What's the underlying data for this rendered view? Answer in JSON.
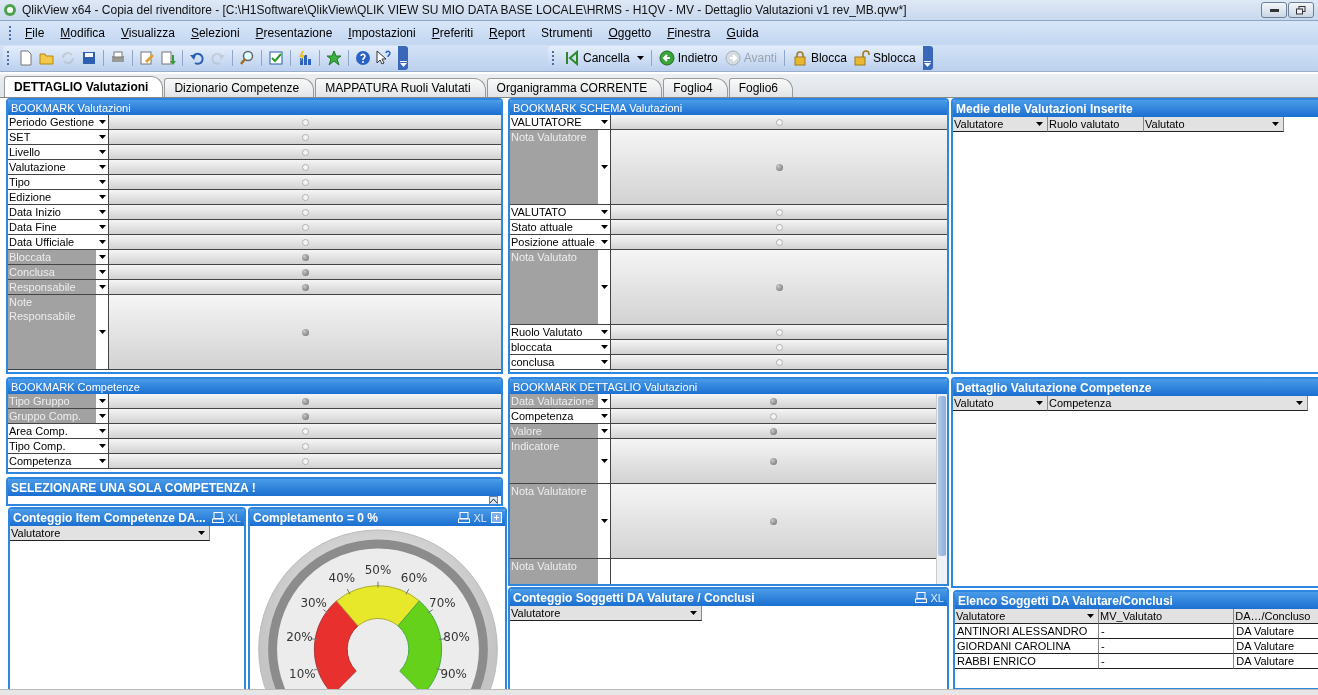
{
  "window": {
    "title": "QlikView x64 - Copia del rivenditore - [C:\\H1Software\\QlikView\\QLIK VIEW SU MIO DATA BASE LOCALE\\HRMS - H1QV - MV - Dettaglio Valutazioni v1 rev_MB.qvw*]"
  },
  "menu": [
    {
      "label": "File",
      "underlined": true
    },
    {
      "label": "Modifica",
      "underlined": true
    },
    {
      "label": "Visualizza",
      "underlined": true
    },
    {
      "label": "Selezioni",
      "underlined": true
    },
    {
      "label": "Presentazione",
      "underlined": true
    },
    {
      "label": "Impostazioni",
      "underlined": true
    },
    {
      "label": "Preferiti",
      "underlined": true
    },
    {
      "label": "Report",
      "underlined": true
    },
    {
      "label": "Strumenti",
      "underlined": false
    },
    {
      "label": "Oggetto",
      "underlined": true
    },
    {
      "label": "Finestra",
      "underlined": true
    },
    {
      "label": "Guida",
      "underlined": true
    }
  ],
  "toolbar": [
    {
      "kind": "new",
      "disabled": false
    },
    {
      "kind": "open",
      "disabled": false
    },
    {
      "kind": "reload",
      "disabled": true
    },
    {
      "kind": "save",
      "disabled": false
    },
    {
      "kind": "separator"
    },
    {
      "kind": "print",
      "disabled": false
    },
    {
      "kind": "separator"
    },
    {
      "kind": "edit",
      "disabled": false
    },
    {
      "kind": "import",
      "disabled": false
    },
    {
      "kind": "separator"
    },
    {
      "kind": "undo",
      "disabled": false
    },
    {
      "kind": "redo",
      "disabled": true
    },
    {
      "kind": "separator"
    },
    {
      "kind": "search",
      "disabled": false
    },
    {
      "kind": "separator"
    },
    {
      "kind": "check",
      "disabled": false
    },
    {
      "kind": "separator"
    },
    {
      "kind": "chart",
      "disabled": false
    },
    {
      "kind": "separator"
    },
    {
      "kind": "star",
      "disabled": false
    },
    {
      "kind": "separator"
    },
    {
      "kind": "help",
      "disabled": false
    },
    {
      "kind": "whatsthis",
      "disabled": false
    }
  ],
  "selection_toolbar": [
    {
      "kind": "clear",
      "label": "Cancella",
      "disabled": false,
      "dropdown": true
    },
    {
      "kind": "back",
      "label": "Indietro",
      "disabled": false,
      "dropdown": false
    },
    {
      "kind": "forward",
      "label": "Avanti",
      "disabled": true,
      "dropdown": false
    },
    {
      "kind": "lock",
      "label": "Blocca",
      "disabled": false,
      "dropdown": false
    },
    {
      "kind": "unlock",
      "label": "Sblocca",
      "disabled": false,
      "dropdown": false
    }
  ],
  "tabs": [
    {
      "label": "DETTAGLIO Valutazioni",
      "selected": true
    },
    {
      "label": "Dizionario Competenze",
      "selected": false
    },
    {
      "label": "MAPPATURA Ruoli Valutati",
      "selected": false
    },
    {
      "label": "Organigramma CORRENTE",
      "selected": false
    },
    {
      "label": "Foglio4",
      "selected": false
    },
    {
      "label": "Foglio6",
      "selected": false
    }
  ],
  "objects": [
    {
      "kind": "multibox",
      "title": "BOOKMARK Valutazioni",
      "fields": [
        {
          "label": "Periodo Gestione",
          "kind": "line",
          "greyed": false
        },
        {
          "label": "SET",
          "kind": "line",
          "greyed": false
        },
        {
          "label": "Livello",
          "kind": "line",
          "greyed": false
        },
        {
          "label": "Valutazione",
          "kind": "line",
          "greyed": false
        },
        {
          "label": "Tipo",
          "kind": "line",
          "greyed": false
        },
        {
          "label": "Edizione",
          "kind": "line",
          "greyed": false
        },
        {
          "label": "Data Inizio",
          "kind": "line",
          "greyed": false
        },
        {
          "label": "Data Fine",
          "kind": "line",
          "greyed": false
        },
        {
          "label": "Data Ufficiale",
          "kind": "line",
          "greyed": false
        },
        {
          "label": "Bloccata",
          "kind": "line",
          "greyed": true
        },
        {
          "label": "Conclusa",
          "kind": "line",
          "greyed": true
        },
        {
          "label": "Responsabile",
          "kind": "line",
          "greyed": true
        },
        {
          "label": "Note Responsabile",
          "kind": "memo",
          "greyed": true
        }
      ]
    },
    {
      "kind": "multibox",
      "title": "BOOKMARK SCHEMA Valutazioni",
      "fields": [
        {
          "label": "VALUTATORE",
          "kind": "line",
          "greyed": false
        },
        {
          "label": "Nota Valutatore",
          "kind": "memo",
          "greyed": true
        },
        {
          "label": "VALUTATO",
          "kind": "line",
          "greyed": false
        },
        {
          "label": "Stato attuale",
          "kind": "line",
          "greyed": false
        },
        {
          "label": "Posizione attuale",
          "kind": "line",
          "greyed": false
        },
        {
          "label": "Nota Valutato",
          "kind": "memo",
          "greyed": true
        },
        {
          "label": "Ruolo Valutato",
          "kind": "line",
          "greyed": false
        },
        {
          "label": "bloccata",
          "kind": "line",
          "greyed": false
        },
        {
          "label": "conclusa",
          "kind": "line",
          "greyed": false
        }
      ]
    },
    {
      "kind": "table",
      "title": "Medie delle Valutazioni Inserite",
      "columns": [
        {
          "label": "Valutatore",
          "dropdown": true
        },
        {
          "label": "Ruolo valutato",
          "dropdown": false
        },
        {
          "label": "Valutato",
          "dropdown": true
        }
      ]
    },
    {
      "kind": "multibox",
      "title": "BOOKMARK Competenze",
      "fields": [
        {
          "label": "Tipo Gruppo",
          "kind": "line",
          "greyed": true
        },
        {
          "label": "Gruppo Comp.",
          "kind": "line",
          "greyed": true
        },
        {
          "label": "Area Comp.",
          "kind": "line",
          "greyed": false
        },
        {
          "label": "Tipo Comp.",
          "kind": "line",
          "greyed": false
        },
        {
          "label": "Competenza",
          "kind": "line",
          "greyed": false
        }
      ]
    },
    {
      "kind": "multibox",
      "title": "BOOKMARK DETTAGLIO Valutazioni",
      "fields": [
        {
          "label": "Data Valutazione",
          "kind": "line",
          "greyed": true
        },
        {
          "label": "Competenza",
          "kind": "line",
          "greyed": false
        },
        {
          "label": "Valore",
          "kind": "line",
          "greyed": true
        },
        {
          "label": "Indicatore",
          "kind": "note",
          "greyed": true
        },
        {
          "label": "Nota Valutatore",
          "kind": "memo",
          "greyed": true
        },
        {
          "label": "Nota Valutato",
          "kind": "cut",
          "greyed": true
        }
      ]
    },
    {
      "kind": "table",
      "title": "Dettaglio Valutazione Competenze",
      "columns": [
        {
          "label": "Valutato",
          "dropdown": true
        },
        {
          "label": "Competenza",
          "dropdown": true
        }
      ]
    },
    {
      "kind": "text",
      "title": "SELEZIONARE UNA SOLA COMPETENZA !"
    },
    {
      "kind": "table",
      "title": "Conteggio Item Competenze DA...",
      "caption_buttons": [
        {
          "kind": "print"
        },
        {
          "kind": "excel",
          "label": "XL"
        }
      ],
      "columns": [
        {
          "label": "Valutatore",
          "dropdown": true
        }
      ]
    },
    {
      "kind": "gauge",
      "title": "Completamento = 0 %",
      "caption_buttons": [
        {
          "kind": "print"
        },
        {
          "kind": "excel",
          "label": "XL"
        },
        {
          "kind": "maximize"
        }
      ],
      "ticks": [
        "10%",
        "20%",
        "30%",
        "40%",
        "50%",
        "60%",
        "70%",
        "80%",
        "90%"
      ]
    },
    {
      "kind": "table",
      "title": "Conteggio Soggetti DA Valutare / Conclusi",
      "caption_buttons": [
        {
          "kind": "print"
        },
        {
          "kind": "excel",
          "label": "XL"
        }
      ],
      "columns": [
        {
          "label": "Valutatore",
          "dropdown": true
        }
      ]
    },
    {
      "kind": "table",
      "title": "Elenco Soggetti DA Valutare/Conclusi",
      "columns": [
        {
          "label": "Valutatore",
          "dropdown": true
        },
        {
          "label": "MV_Valutato",
          "dropdown": false
        },
        {
          "label": "DA…/Concluso",
          "dropdown": false
        }
      ],
      "rows": [
        [
          "ANTINORI ALESSANDRO",
          "-",
          "DA Valutare"
        ],
        [
          "GIORDANI CAROLINA",
          "-",
          "DA Valutare"
        ],
        [
          "RABBI ENRICO",
          "-",
          "DA Valutare"
        ]
      ]
    }
  ]
}
